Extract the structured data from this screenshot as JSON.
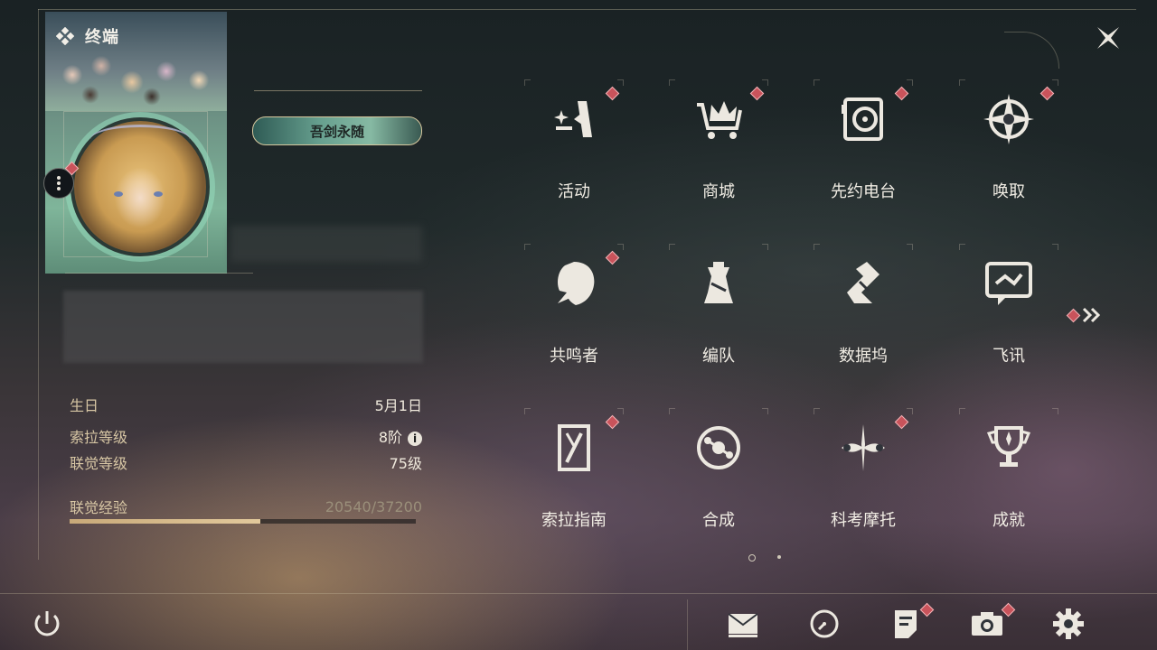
{
  "header": {
    "title": "终端",
    "icon": "grid-diamond-icon"
  },
  "profile": {
    "title_badge": "吾剑永随",
    "stats": [
      {
        "label": "生日",
        "value": "5月1日"
      },
      {
        "label": "索拉等级",
        "value": "8阶",
        "has_info": true
      },
      {
        "label": "联觉等级",
        "value": "75级"
      }
    ],
    "exp": {
      "label": "联觉经验",
      "value": "20540/37200",
      "progress": 0.552
    }
  },
  "menu": [
    {
      "label": "活动",
      "icon": "sparkle-flag-icon",
      "badge": true
    },
    {
      "label": "商城",
      "icon": "crown-cart-icon",
      "badge": true
    },
    {
      "label": "先约电台",
      "icon": "radio-speaker-icon",
      "badge": true
    },
    {
      "label": "唤取",
      "icon": "compass-star-icon",
      "badge": true
    },
    {
      "label": "共鸣者",
      "icon": "character-head-icon",
      "badge": true
    },
    {
      "label": "编队",
      "icon": "chess-piece-icon",
      "badge": false
    },
    {
      "label": "数据坞",
      "icon": "data-dock-icon",
      "badge": false
    },
    {
      "label": "飞讯",
      "icon": "message-bubble-icon",
      "badge": false
    },
    {
      "label": "索拉指南",
      "icon": "guide-book-icon",
      "badge": true
    },
    {
      "label": "合成",
      "icon": "synthesis-orb-icon",
      "badge": false
    },
    {
      "label": "科考摩托",
      "icon": "motorbike-icon",
      "badge": true
    },
    {
      "label": "成就",
      "icon": "trophy-icon",
      "badge": false
    }
  ],
  "pagination": {
    "current": 1,
    "total": 2
  },
  "bottom_bar": [
    {
      "name": "power-button",
      "icon": "power-icon",
      "badge": false
    },
    {
      "name": "mail-button",
      "icon": "mail-icon",
      "badge": false
    },
    {
      "name": "history-button",
      "icon": "clock-icon",
      "badge": false
    },
    {
      "name": "notes-button",
      "icon": "document-icon",
      "badge": true
    },
    {
      "name": "camera-button",
      "icon": "camera-icon",
      "badge": true
    },
    {
      "name": "settings-button",
      "icon": "gear-icon",
      "badge": false
    }
  ],
  "colors": {
    "accent": "#c9535b",
    "label_gold": "#d7c6a4",
    "exp_fill": "#d2b787",
    "badge_teal": "#67a08f"
  }
}
